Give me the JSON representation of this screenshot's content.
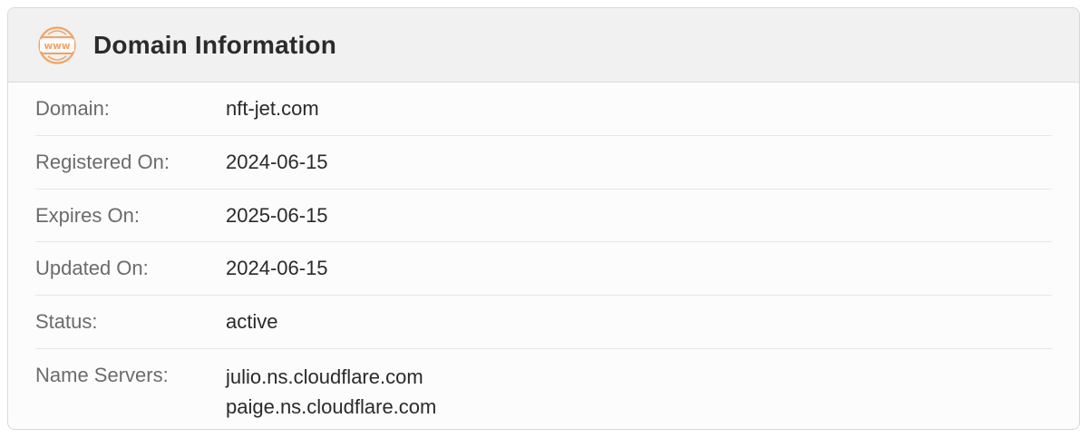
{
  "card": {
    "title": "Domain Information",
    "icon": "www-icon",
    "accent_color": "#f0a468"
  },
  "rows": {
    "domain": {
      "label": "Domain:",
      "value": "nft-jet.com"
    },
    "registered": {
      "label": "Registered On:",
      "value": "2024-06-15"
    },
    "expires": {
      "label": "Expires On:",
      "value": "2025-06-15"
    },
    "updated": {
      "label": "Updated On:",
      "value": "2024-06-15"
    },
    "status": {
      "label": "Status:",
      "value": "active"
    },
    "name_servers": {
      "label": "Name Servers:",
      "values": [
        "julio.ns.cloudflare.com",
        "paige.ns.cloudflare.com"
      ]
    }
  }
}
